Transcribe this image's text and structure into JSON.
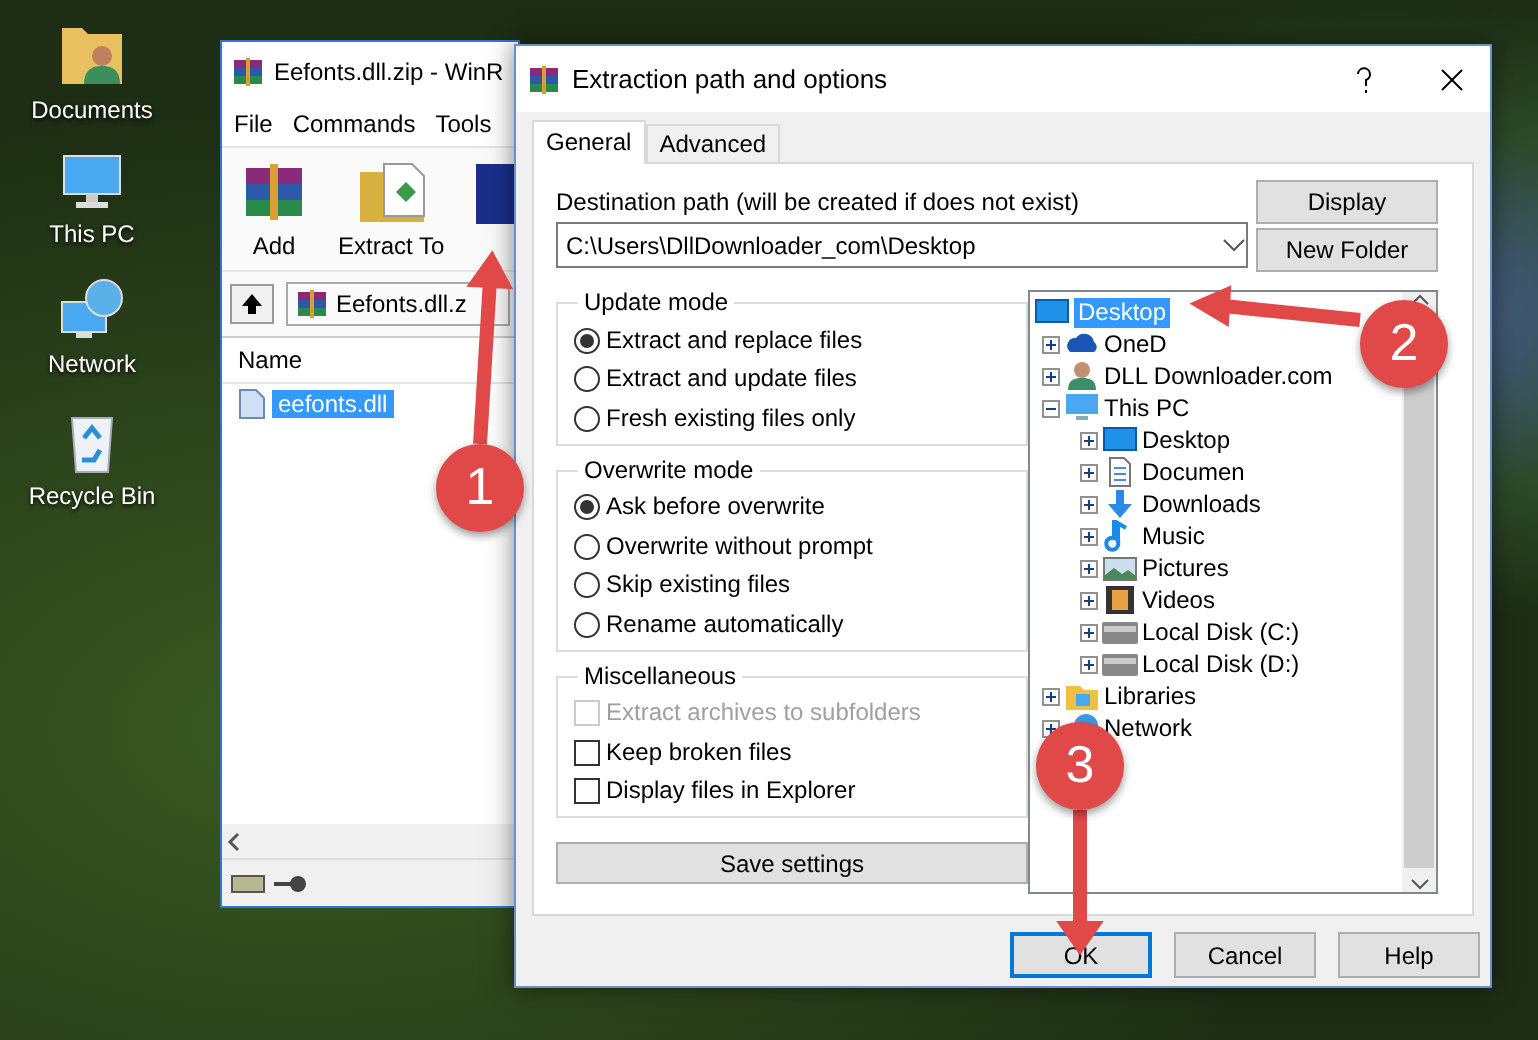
{
  "desktop_icons": [
    {
      "label": "Documents",
      "kind": "documents"
    },
    {
      "label": "This PC",
      "kind": "pc"
    },
    {
      "label": "Network",
      "kind": "network"
    },
    {
      "label": "Recycle Bin",
      "kind": "recycle"
    }
  ],
  "winrar": {
    "title": "Eefonts.dll.zip - WinR",
    "menu": [
      "File",
      "Commands",
      "Tools"
    ],
    "toolbar": [
      {
        "label": "Add",
        "kind": "add"
      },
      {
        "label": "Extract To",
        "kind": "extract"
      },
      {
        "kind": "book"
      }
    ],
    "address": "Eefonts.dll.z",
    "columns": [
      "Name"
    ],
    "files": [
      {
        "name": "eefonts.dll",
        "selected": true
      }
    ]
  },
  "dialog": {
    "title": "Extraction path and options",
    "tabs": [
      {
        "label": "General",
        "selected": true
      },
      {
        "label": "Advanced",
        "selected": false
      }
    ],
    "destination_label": "Destination path (will be created if does not exist)",
    "destination_value": "C:\\Users\\DllDownloader_com\\Desktop",
    "side_buttons": [
      "Display",
      "New Folder"
    ],
    "groups": [
      {
        "title": "Update mode",
        "options": [
          {
            "kind": "radio",
            "label": "Extract and replace files",
            "selected": true
          },
          {
            "kind": "radio",
            "label": "Extract and update files",
            "selected": false
          },
          {
            "kind": "radio",
            "label": "Fresh existing files only",
            "selected": false
          }
        ]
      },
      {
        "title": "Overwrite mode",
        "options": [
          {
            "kind": "radio",
            "label": "Ask before overwrite",
            "selected": true
          },
          {
            "kind": "radio",
            "label": "Overwrite without prompt",
            "selected": false
          },
          {
            "kind": "radio",
            "label": "Skip existing files",
            "selected": false
          },
          {
            "kind": "radio",
            "label": "Rename automatically",
            "selected": false
          }
        ]
      },
      {
        "title": "Miscellaneous",
        "options": [
          {
            "kind": "checkbox",
            "label": "Extract archives to subfolders",
            "checked": false,
            "disabled": true
          },
          {
            "kind": "checkbox",
            "label": "Keep broken files",
            "checked": false,
            "disabled": false
          },
          {
            "kind": "checkbox",
            "label": "Display files in Explorer",
            "checked": false,
            "disabled": false
          }
        ]
      }
    ],
    "save_button": "Save settings",
    "tree": [
      {
        "label": "Desktop",
        "kind": "desktop",
        "selected": true,
        "children": [
          {
            "label": "OneD",
            "kind": "cloud",
            "expanded": false,
            "selected": false
          },
          {
            "label": "DLL Downloader.com",
            "kind": "user",
            "expanded": false,
            "selected": false
          },
          {
            "label": "This PC",
            "kind": "pc",
            "expanded": true,
            "selected": false,
            "children": [
              {
                "label": "Desktop",
                "kind": "desktop",
                "expanded": false,
                "selected": false
              },
              {
                "label": "Documen",
                "kind": "document",
                "expanded": false,
                "selected": false
              },
              {
                "label": "Downloads",
                "kind": "download",
                "expanded": false,
                "selected": false
              },
              {
                "label": "Music",
                "kind": "music",
                "expanded": false,
                "selected": false
              },
              {
                "label": "Pictures",
                "kind": "pictures",
                "expanded": false,
                "selected": false
              },
              {
                "label": "Videos",
                "kind": "videos",
                "expanded": false,
                "selected": false
              },
              {
                "label": "Local Disk (C:)",
                "kind": "drive",
                "expanded": false,
                "selected": false
              },
              {
                "label": "Local Disk (D:)",
                "kind": "drive",
                "expanded": false,
                "selected": false
              }
            ]
          },
          {
            "label": "Libraries",
            "kind": "libraries",
            "expanded": false,
            "selected": false
          },
          {
            "label": "Network",
            "kind": "network",
            "expanded": false,
            "selected": false
          }
        ]
      }
    ],
    "buttons": [
      {
        "label": "OK",
        "default": true
      },
      {
        "label": "Cancel",
        "default": false
      },
      {
        "label": "Help",
        "default": false
      }
    ]
  },
  "callouts": [
    {
      "label": "1"
    },
    {
      "label": "2"
    },
    {
      "label": "3"
    }
  ]
}
